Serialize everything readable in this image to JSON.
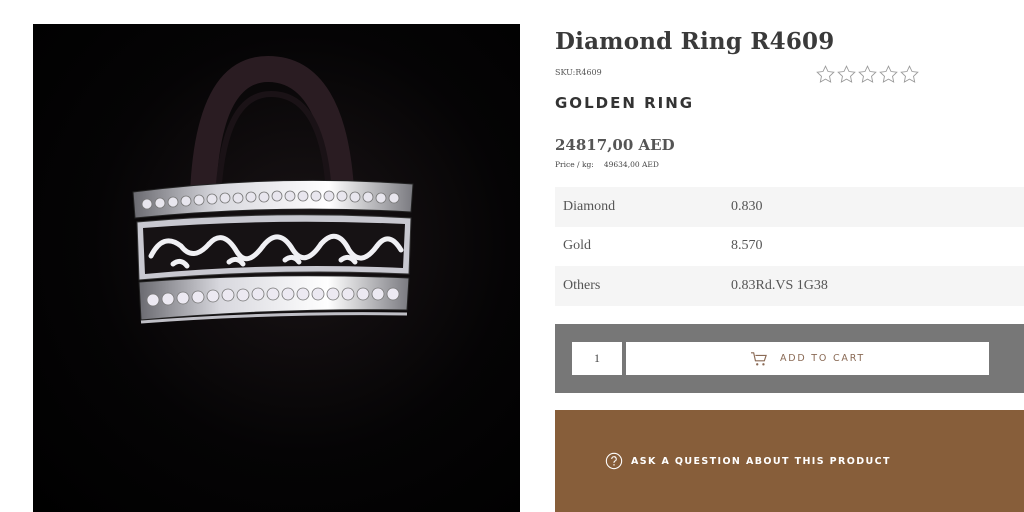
{
  "product": {
    "title": "Diamond Ring R4609",
    "sku": "SKU:R4609",
    "subtitle": "GOLDEN RING",
    "price": "24817,00 AED",
    "price_per_kg_label": "Price / kg:",
    "price_per_kg_value": "49634,00 AED",
    "rating": {
      "stars_total": 5,
      "stars_filled": 0
    }
  },
  "specs": [
    {
      "name": "Diamond",
      "value": "0.830"
    },
    {
      "name": "Gold",
      "value": "8.570"
    },
    {
      "name": "Others",
      "value": "0.83Rd.VS 1G38"
    }
  ],
  "cart": {
    "quantity": "1",
    "add_to_cart_label": "ADD TO CART",
    "cart_icon": "shopping-cart-icon"
  },
  "ask": {
    "label": "ASK A QUESTION ABOUT THIS PRODUCT",
    "icon": "question-circle-icon"
  },
  "colors": {
    "cart_bar": "#777777",
    "ask_bar": "#875e3a",
    "accent_text": "#8a6a55"
  }
}
